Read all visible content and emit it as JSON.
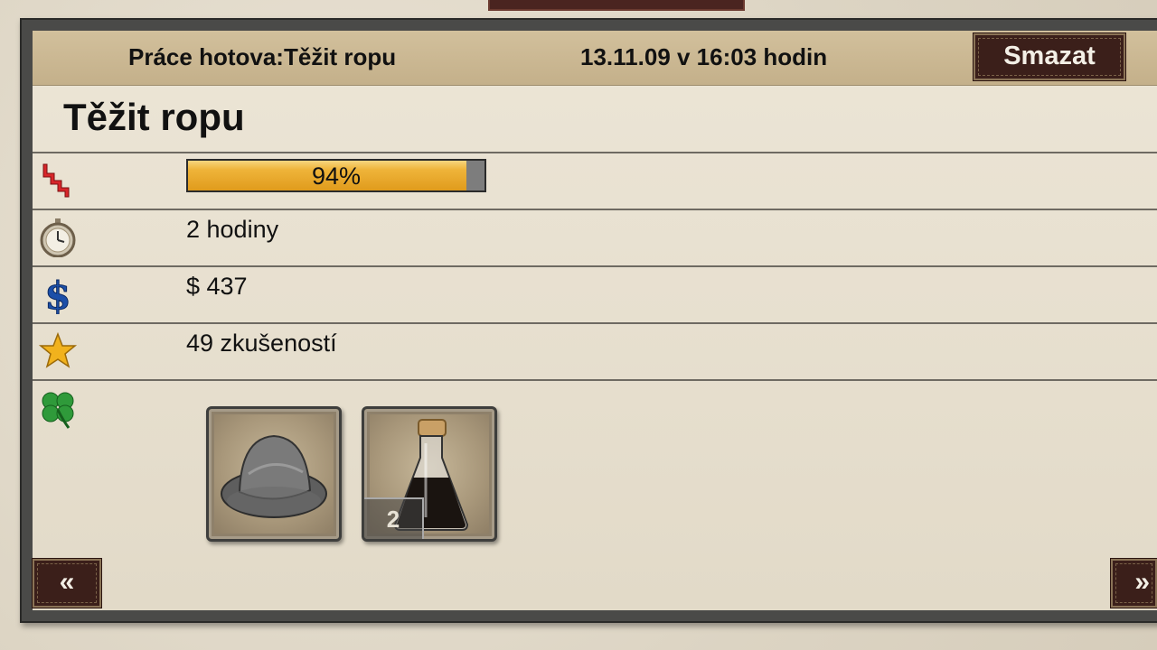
{
  "header": {
    "title": "Práce hotova:Těžit ropu",
    "date": "13.11.09 v 16:03 hodin",
    "delete_label": "Smazat"
  },
  "job": {
    "title": "Těžit ropu"
  },
  "stats": {
    "motivation": {
      "icon": "motivation-lightning-icon",
      "percent_label": "94%",
      "percent": 94
    },
    "duration": {
      "icon": "stopwatch-icon",
      "value": "2 hodiny"
    },
    "money": {
      "icon": "dollar-icon",
      "value": "$ 437"
    },
    "experience": {
      "icon": "star-icon",
      "value": "49 zkušeností"
    },
    "luck": {
      "icon": "clover-icon"
    }
  },
  "items": [
    {
      "icon": "gray-hat-icon"
    },
    {
      "icon": "oil-bottle-icon",
      "count": "2"
    }
  ],
  "nav": {
    "prev_label": "«",
    "next_label": "»"
  },
  "colors": {
    "header_bg": "#cbb894",
    "button_bg": "#3b1f1a",
    "progress_fill": "#e9a827",
    "panel_bg": "#e9e1d1"
  }
}
